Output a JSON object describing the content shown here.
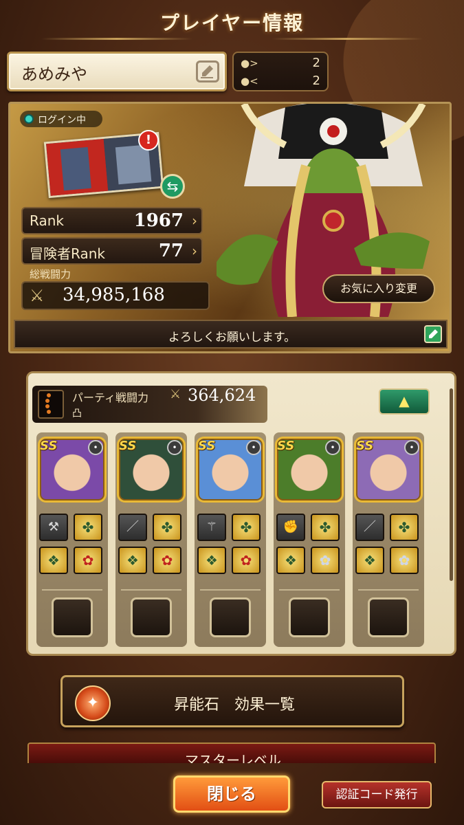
{
  "header": {
    "title": "プレイヤー情報"
  },
  "profile": {
    "name": "あめみや",
    "following": "2",
    "followers": "2",
    "login_status": "ログイン中",
    "alert_mark": "!",
    "rank_label": "Rank",
    "rank_value": "1967",
    "adventurer_rank_label": "冒険者Rank",
    "adventurer_rank_value": "77",
    "total_power_label": "総戦闘力",
    "total_power_value": "34,985,168",
    "favorite_button": "お気に入り変更",
    "comment": "よろしくお願いします。"
  },
  "party": {
    "power_label": "パーティ戦闘力",
    "power_value": "364,624",
    "subtitle": "凸",
    "units": [
      {
        "rarity": "SS",
        "weapon": "hammer-icon",
        "accent": "#7b4aa8"
      },
      {
        "rarity": "SS",
        "weapon": "sword-icon",
        "accent": "#2f4f3a"
      },
      {
        "rarity": "SS",
        "weapon": "staff-icon",
        "accent": "#5a8fd6"
      },
      {
        "rarity": "SS",
        "weapon": "fist-icon",
        "accent": "#4c7d2a"
      },
      {
        "rarity": "SS",
        "weapon": "sword-icon",
        "accent": "#8d6bb5"
      }
    ]
  },
  "buttons": {
    "stone_effects": "昇能石　効果一覧",
    "master_level": "マスターレベル",
    "close": "閉じる",
    "auth_code": "認証コード発行"
  },
  "colors": {
    "accent_gold": "#c8a05a",
    "close_orange": "#e24f14",
    "auth_red": "#b5322a"
  }
}
